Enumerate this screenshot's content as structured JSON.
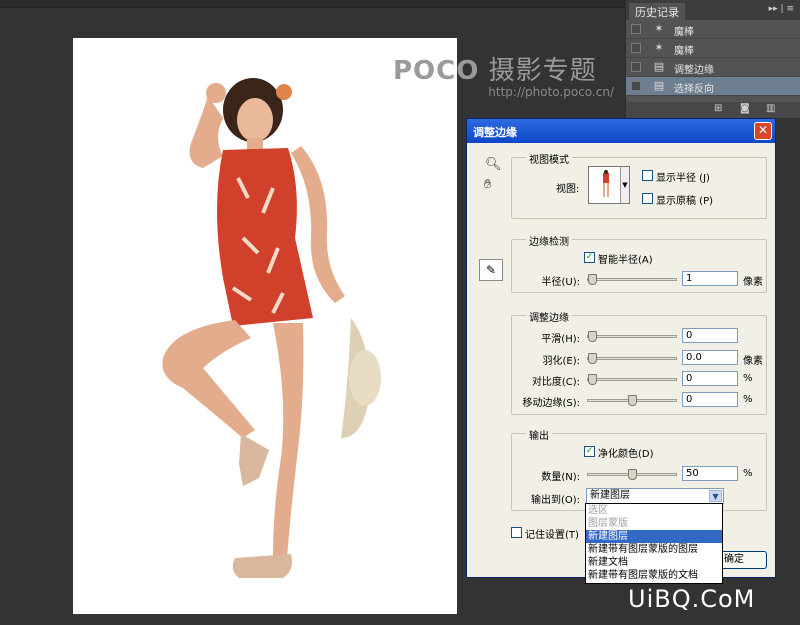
{
  "watermark": {
    "brand_latin": "POCO",
    "brand_cn": "摄影专题",
    "url": "http://photo.poco.cn/"
  },
  "history": {
    "tab": "历史记录",
    "items": [
      {
        "label": "魔棒",
        "icon": "magic-wand-icon"
      },
      {
        "label": "魔棒",
        "icon": "magic-wand-icon"
      },
      {
        "label": "调整边缘",
        "icon": "document-icon"
      },
      {
        "label": "选择反向",
        "icon": "document-icon",
        "selected": true
      }
    ]
  },
  "dialog": {
    "title": "调整边缘",
    "view_mode": {
      "title": "视图模式",
      "view_label": "视图:",
      "show_radius": "显示半径 (J)",
      "show_original": "显示原稿 (P)"
    },
    "edge_detection": {
      "title": "边缘检测",
      "smart_radius": "智能半径(A)",
      "radius_label": "半径(U):",
      "radius_value": "1",
      "radius_unit": "像素"
    },
    "adjust_edge": {
      "title": "调整边缘",
      "smooth_label": "平滑(H):",
      "smooth_value": "0",
      "feather_label": "羽化(E):",
      "feather_value": "0.0",
      "feather_unit": "像素",
      "contrast_label": "对比度(C):",
      "contrast_value": "0",
      "contrast_unit": "%",
      "shift_label": "移动边缘(S):",
      "shift_value": "0",
      "shift_unit": "%"
    },
    "output": {
      "title": "输出",
      "decontaminate": "净化颜色(D)",
      "amount_label": "数量(N):",
      "amount_value": "50",
      "amount_unit": "%",
      "output_to_label": "输出到(O):",
      "output_to_value": "新建图层",
      "options": [
        "选区",
        "图层蒙版",
        "新建图层",
        "新建带有图层蒙版的图层",
        "新建文档",
        "新建带有图层蒙版的文档"
      ]
    },
    "remember": "记住设置(T)",
    "ok": "确定"
  },
  "site_logo": "UiBQ.CoM"
}
